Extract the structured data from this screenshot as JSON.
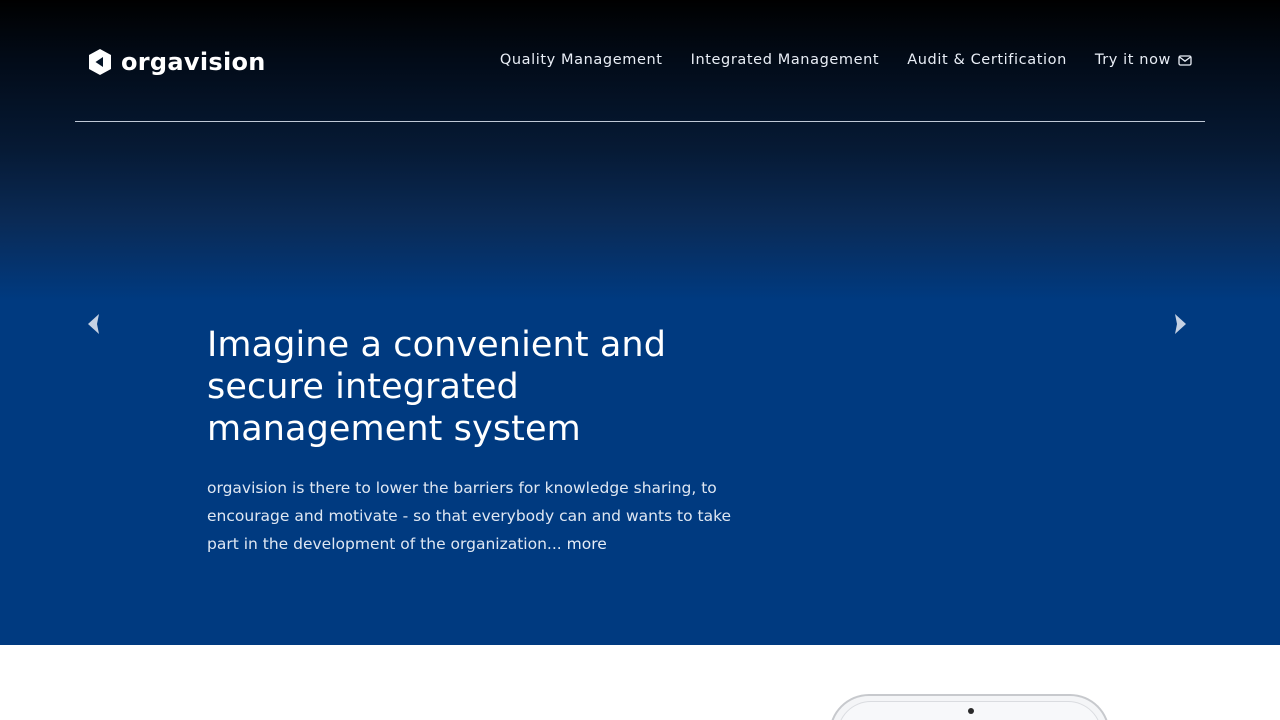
{
  "brand": {
    "name": "orgavision",
    "logo_icon": "play-shield-icon"
  },
  "nav": {
    "items": [
      {
        "label": "Quality Management"
      },
      {
        "label": "Integrated Management"
      },
      {
        "label": "Audit & Certification"
      },
      {
        "label": "Try it now",
        "icon": "mail-icon"
      }
    ]
  },
  "carousel": {
    "prev_icon": "chevron-left-icon",
    "next_icon": "chevron-right-icon",
    "slide": {
      "title": "Imagine a convenient and secure integrated management system",
      "text": "orgavision is there to lower the barriers for knowledge sharing, to encourage and motivate - so that everybody can and wants to take part in the development of the organization... ",
      "more_label": "more"
    }
  },
  "colors": {
    "hero_blue": "#003a80",
    "hero_top": "#000000",
    "text": "#ffffff"
  }
}
